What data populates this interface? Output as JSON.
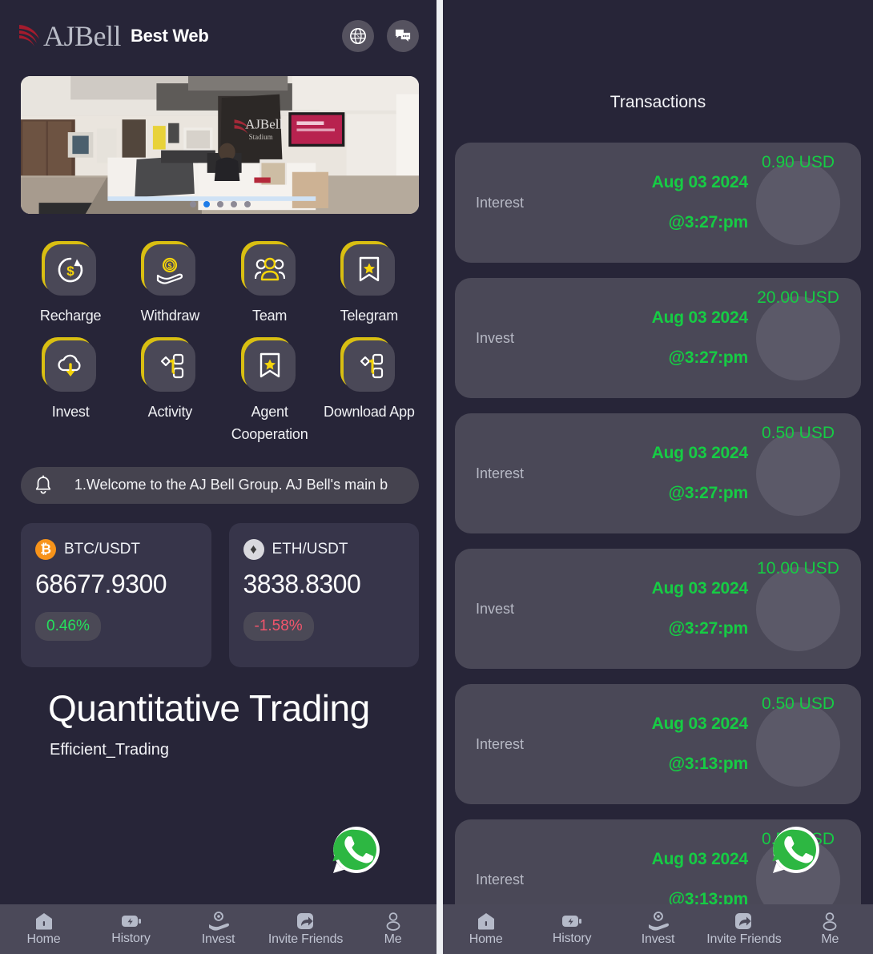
{
  "header": {
    "brand_name": "AJBell",
    "brand_suffix": "Best Web",
    "globe_icon": "globe-icon",
    "chat_icon": "chat-icon"
  },
  "banner": {
    "alt": "AJ Bell Stadium reception lobby",
    "dots_count": 5,
    "active_dot": 1
  },
  "menu": {
    "items": [
      {
        "label": "Recharge",
        "icon": "recharge-icon"
      },
      {
        "label": "Withdraw",
        "icon": "withdraw-icon"
      },
      {
        "label": "Team",
        "icon": "team-icon"
      },
      {
        "label": "Telegram",
        "icon": "telegram-icon"
      },
      {
        "label": "Invest",
        "icon": "invest-icon"
      },
      {
        "label": "Activity",
        "icon": "activity-icon"
      },
      {
        "label": "Agent Cooperation",
        "icon": "agent-cooperation-icon"
      },
      {
        "label": "Download App",
        "icon": "download-app-icon"
      }
    ]
  },
  "announcement": {
    "icon": "bell-icon",
    "text": "1.Welcome to the AJ Bell Group. AJ Bell's main b"
  },
  "crypto": {
    "cards": [
      {
        "symbol": "B",
        "icon": "bitcoin-icon",
        "pair": "BTC/USDT",
        "price": "68677.9300",
        "change": "0.46%",
        "direction": "up",
        "color": "#f7931a"
      },
      {
        "symbol": "E",
        "icon": "ethereum-icon",
        "pair": "ETH/USDT",
        "price": "3838.8300",
        "change": "-1.58%",
        "direction": "down",
        "color": "#d9d9de"
      }
    ]
  },
  "hero": {
    "title": "Quantitative Trading",
    "subtitle": "Efficient_Trading"
  },
  "transactions": {
    "title": "Transactions",
    "rows": [
      {
        "type": "Interest",
        "date": "Aug 03 2024",
        "time": "@3:27:pm",
        "amount": "0.90 USD"
      },
      {
        "type": "Invest",
        "date": "Aug 03 2024",
        "time": "@3:27:pm",
        "amount": "20.00 USD"
      },
      {
        "type": "Interest",
        "date": "Aug 03 2024",
        "time": "@3:27:pm",
        "amount": "0.50 USD"
      },
      {
        "type": "Invest",
        "date": "Aug 03 2024",
        "time": "@3:27:pm",
        "amount": "10.00 USD"
      },
      {
        "type": "Interest",
        "date": "Aug 03 2024",
        "time": "@3:13:pm",
        "amount": "0.50 USD"
      },
      {
        "type": "Interest",
        "date": "Aug 03 2024",
        "time": "@3:13:pm",
        "amount": "0.50 USD"
      }
    ]
  },
  "bottom_nav": {
    "items": [
      {
        "label": "Home",
        "icon": "home-icon"
      },
      {
        "label": "History",
        "icon": "history-icon"
      },
      {
        "label": "Invest",
        "icon": "invest-icon"
      },
      {
        "label": "Invite Friends",
        "icon": "invite-friends-icon"
      },
      {
        "label": "Me",
        "icon": "profile-icon"
      }
    ]
  },
  "floating_action": {
    "icon": "whatsapp-icon",
    "color": "#2db742"
  },
  "colors": {
    "app_background": "#272538",
    "card_background": "#4a4857",
    "accent_yellow": "#d9bf12",
    "positive_green": "#16cc44",
    "negative_red": "#f1556c",
    "brand_red": "#a41b2d"
  }
}
